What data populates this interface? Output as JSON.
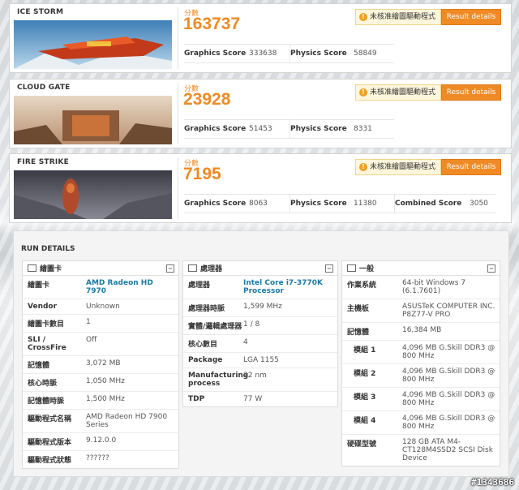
{
  "benchmarks": [
    {
      "title": "ICE STORM",
      "score_label": "分數",
      "score": "163737",
      "warning": "未核准繪圖驅動程式",
      "button": "Result details",
      "subscores": [
        {
          "label": "Graphics Score",
          "value": "333638"
        },
        {
          "label": "Physics Score",
          "value": "58849"
        }
      ]
    },
    {
      "title": "CLOUD GATE",
      "score_label": "分數",
      "score": "23928",
      "warning": "未核准繪圖驅動程式",
      "button": "Result details",
      "subscores": [
        {
          "label": "Graphics Score",
          "value": "51453"
        },
        {
          "label": "Physics Score",
          "value": "8331"
        }
      ]
    },
    {
      "title": "FIRE STRIKE",
      "score_label": "分數",
      "score": "7195",
      "warning": "未核准繪圖驅動程式",
      "button": "Result details",
      "subscores": [
        {
          "label": "Graphics Score",
          "value": "8063"
        },
        {
          "label": "Physics Score",
          "value": "11380"
        },
        {
          "label": "Combined Score",
          "value": "3050"
        }
      ]
    }
  ],
  "run_details": {
    "title": "RUN DETAILS",
    "gpu": {
      "header": "繪圖卡",
      "rows": [
        {
          "k": "繪圖卡",
          "v": "AMD Radeon HD 7970"
        },
        {
          "k": "Vendor",
          "v": "Unknown"
        },
        {
          "k": "繪圖卡數目",
          "v": "1"
        },
        {
          "k": "SLI / CrossFire",
          "v": "Off"
        },
        {
          "k": "記憶體",
          "v": "3,072 MB"
        },
        {
          "k": "核心時脈",
          "v": "1,050 MHz"
        },
        {
          "k": "記憶體時脈",
          "v": "1,500 MHz"
        },
        {
          "k": "驅動程式名稱",
          "v": "AMD Radeon HD 7900 Series"
        },
        {
          "k": "驅動程式版本",
          "v": "9.12.0.0"
        },
        {
          "k": "驅動程式狀態",
          "v": "??????"
        }
      ]
    },
    "cpu": {
      "header": "處理器",
      "rows": [
        {
          "k": "處理器",
          "v": "Intel Core i7-3770K Processor"
        },
        {
          "k": "處理器時脈",
          "v": "1,599 MHz"
        },
        {
          "k": "實體/邏輯處理器",
          "v": "1 / 8"
        },
        {
          "k": "核心數目",
          "v": "4"
        },
        {
          "k": "Package",
          "v": "LGA 1155"
        },
        {
          "k": "Manufacturing process",
          "v": "22 nm"
        },
        {
          "k": "TDP",
          "v": "77 W"
        }
      ]
    },
    "general": {
      "header": "一般",
      "rows": [
        {
          "k": "作業系統",
          "v": "64-bit Windows 7 (6.1.7601)"
        },
        {
          "k": "主機板",
          "v": "ASUSTeK COMPUTER INC. P8Z77-V PRO"
        },
        {
          "k": "記憶體",
          "v": "16,384 MB"
        },
        {
          "k": "模組 1",
          "v": "4,096 MB G.Skill DDR3 @ 800 MHz"
        },
        {
          "k": "模組 2",
          "v": "4,096 MB G.Skill DDR3 @ 800 MHz"
        },
        {
          "k": "模組 3",
          "v": "4,096 MB G.Skill DDR3 @ 800 MHz"
        },
        {
          "k": "模組 4",
          "v": "4,096 MB G.Skill DDR3 @ 800 MHz"
        },
        {
          "k": "硬碟型號",
          "v": "128 GB ATA M4-CT128M4SSD2 SCSI Disk Device"
        }
      ]
    }
  },
  "watermark": "#1343686",
  "colors": {
    "accent": "#f08a24",
    "link": "#1a7aa8",
    "warning_bg": "#fdf6dc"
  }
}
